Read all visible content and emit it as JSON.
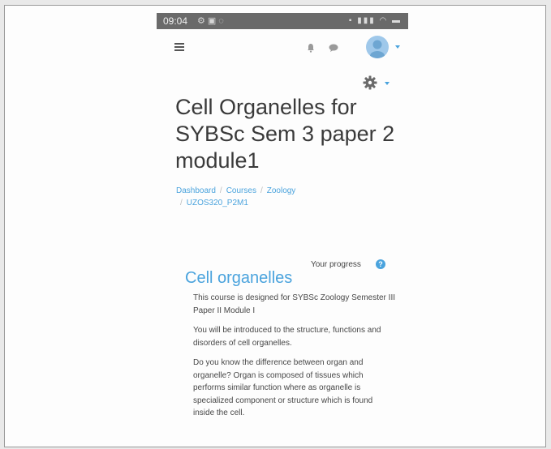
{
  "status_bar": {
    "time": "09:04",
    "left_icons": [
      "settings-icon",
      "image-icon",
      "notification-icon"
    ],
    "right_icons": [
      "nfc-icon",
      "signal-icon",
      "wifi-icon",
      "battery-icon"
    ]
  },
  "navbar": {
    "icons": [
      "menu-icon",
      "bell-icon",
      "chat-icon",
      "avatar",
      "chevron-down-icon"
    ]
  },
  "course": {
    "title": "Cell Organelles for SYBSc Sem 3 paper 2 module1"
  },
  "breadcrumb": {
    "items": [
      "Dashboard",
      "Courses",
      "Zoology",
      "UZOS320_P2M1"
    ],
    "separator": "/"
  },
  "progress": {
    "label": "Your progress"
  },
  "section": {
    "title": "Cell organelles",
    "paragraphs": [
      "This course is designed for SYBSc Zoology Semester III Paper II Module I",
      "You will be introduced to the structure, functions and disorders of cell organelles.",
      "Do you know the difference between organ and organelle?  Organ is composed of tissues which performs similar function where as organelle is specialized component or structure which is found inside the cell."
    ]
  },
  "colors": {
    "accent": "#4aa3dd",
    "status_bar": "#6a6a6a",
    "title_text": "#3a3a3a"
  }
}
